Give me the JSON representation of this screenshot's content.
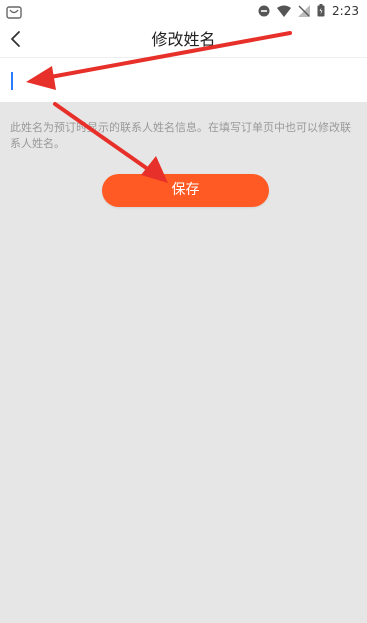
{
  "status_bar": {
    "time": "2:23",
    "icons": [
      "app-notification-icon",
      "do-not-disturb-icon",
      "wifi-icon",
      "signal-icon",
      "battery-icon"
    ]
  },
  "nav": {
    "title": "修改姓名",
    "back_icon": "chevron-left-icon"
  },
  "name_input": {
    "value": "",
    "placeholder": ""
  },
  "hint_text": "此姓名为预订时显示的联系人姓名信息。在填写订单页中也可以修改联系人姓名。",
  "save_button": {
    "label": "保存"
  },
  "colors": {
    "accent": "#ff5a23",
    "annotation_arrow": "#e8302a",
    "caret": "#2b7cff",
    "background": "#e6e6e6"
  }
}
